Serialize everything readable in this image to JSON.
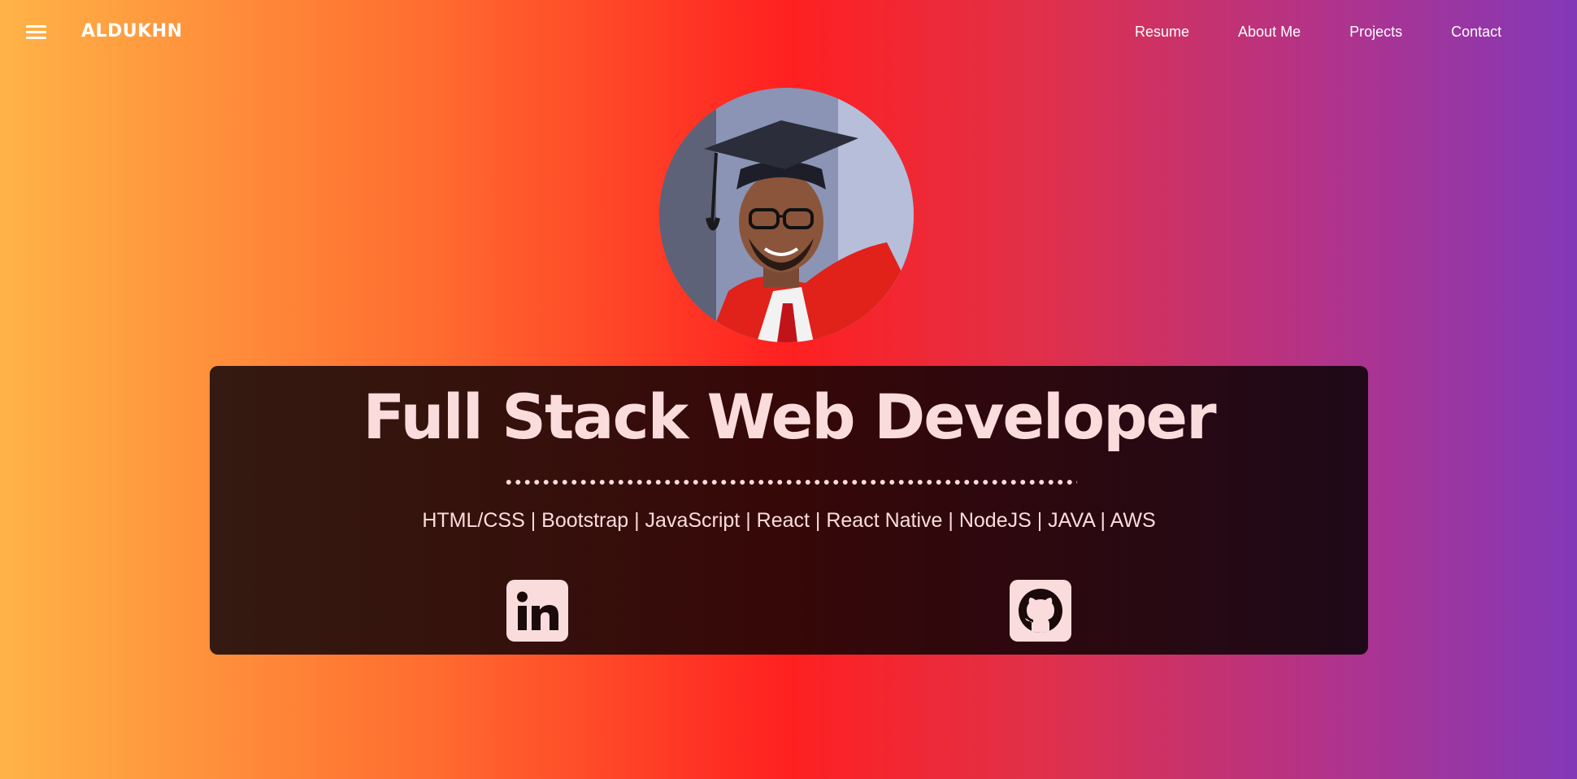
{
  "nav": {
    "menu_icon": "hamburger-menu-icon",
    "brand": "ALDUKHN",
    "links": [
      "Resume",
      "About Me",
      "Projects",
      "Contact"
    ]
  },
  "hero": {
    "avatar_alt": "graduation-portrait",
    "title": "Full Stack Web Developer",
    "skills": "HTML/CSS | Bootstrap | JavaScript | React | React Native | NodeJS | JAVA | AWS"
  },
  "social": {
    "linkedin_icon": "linkedin-icon",
    "github_icon": "github-icon"
  },
  "colors": {
    "accent_text": "#fbdcdc",
    "card_bg": "#360808",
    "gradient_left": "#ffb347",
    "gradient_mid": "#ff2020",
    "gradient_right": "#8338b8"
  }
}
